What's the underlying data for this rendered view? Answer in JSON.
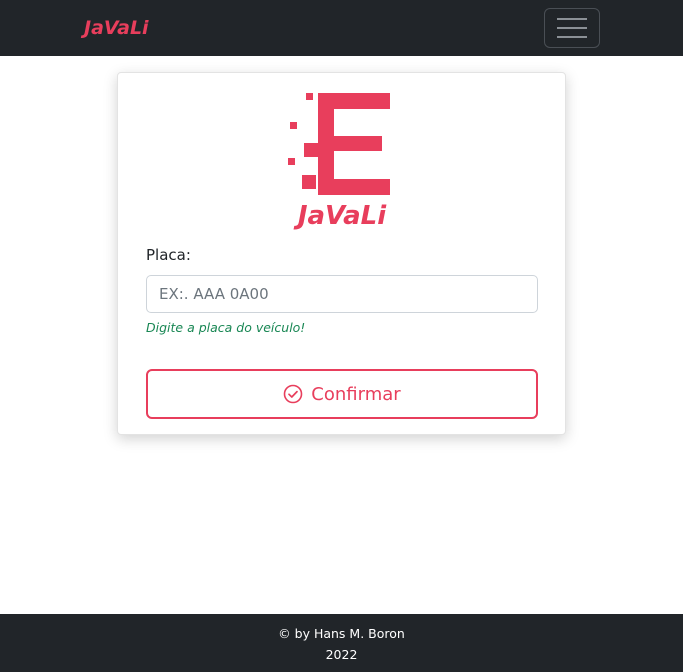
{
  "navbar": {
    "brand": "JaVaLi",
    "toggler_icon": "hamburger-menu-icon"
  },
  "card": {
    "logo_text": "JaVaLi",
    "plate_label": "Placa:",
    "plate_placeholder": "EX:. AAA 0A00",
    "plate_value": "",
    "help_text": "Digite a placa do veículo!",
    "confirm_label": "Confirmar",
    "confirm_icon": "check-circle-icon"
  },
  "footer": {
    "line1": "© by Hans M. Boron",
    "line2": "2022"
  },
  "colors": {
    "accent": "#e83e5c",
    "dark": "#212529",
    "success": "#198754"
  }
}
